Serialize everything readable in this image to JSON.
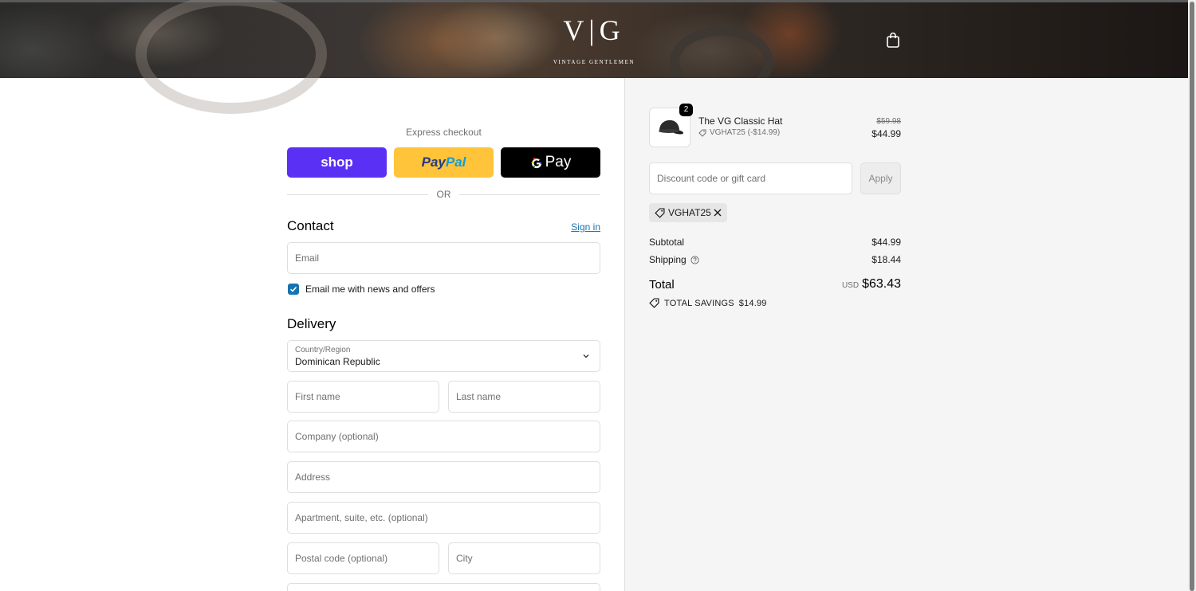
{
  "brand": {
    "mark": "V|G",
    "tagline": "VINTAGE GENTLEMEN"
  },
  "express": {
    "title": "Express checkout",
    "shop_label": "shop",
    "paypal_pay": "Pay",
    "paypal_pal": "Pal",
    "gpay_label": "Pay",
    "or_text": "OR"
  },
  "contact": {
    "title": "Contact",
    "signin": "Sign in",
    "email_placeholder": "Email",
    "newsletter_label": "Email me with news and offers",
    "newsletter_checked": true
  },
  "delivery": {
    "title": "Delivery",
    "country_label": "Country/Region",
    "country_value": "Dominican Republic",
    "first_name": "First name",
    "last_name": "Last name",
    "company": "Company (optional)",
    "address": "Address",
    "apartment": "Apartment, suite, etc. (optional)",
    "postal": "Postal code (optional)",
    "city": "City"
  },
  "summary": {
    "product": {
      "name": "The VG Classic Hat",
      "quantity": "2",
      "discount": "VGHAT25 (-$14.99)",
      "old_price": "$59.98",
      "price": "$44.99"
    },
    "discount_placeholder": "Discount code or gift card",
    "apply_label": "Apply",
    "applied_code": "VGHAT25",
    "subtotal_label": "Subtotal",
    "subtotal": "$44.99",
    "shipping_label": "Shipping",
    "shipping": "$18.44",
    "total_label": "Total",
    "currency": "USD",
    "total": "$63.43",
    "savings_label": "TOTAL SAVINGS",
    "savings": "$14.99"
  },
  "colors": {
    "accent": "#1773b0",
    "shop": "#5a31f4",
    "paypal": "#ffc439"
  }
}
